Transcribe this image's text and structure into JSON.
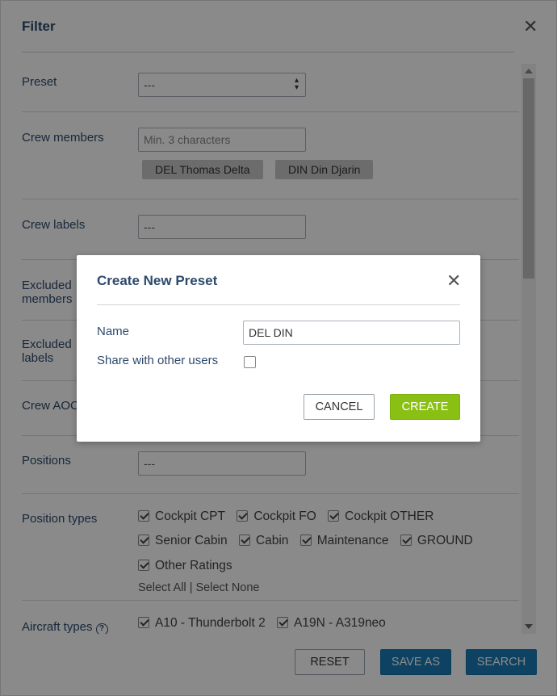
{
  "filter": {
    "title": "Filter",
    "preset": {
      "label": "Preset",
      "value": "---"
    },
    "crew_members": {
      "label": "Crew members",
      "placeholder": "Min. 3 characters",
      "chips": [
        "DEL Thomas Delta",
        "DIN Din Djarin"
      ]
    },
    "crew_labels": {
      "label": "Crew labels",
      "value": "---"
    },
    "excluded_members": {
      "label_line1": "Excluded",
      "label_line2": "members"
    },
    "excluded_labels": {
      "label_line1": "Excluded",
      "label_line2": "labels"
    },
    "crew_aoc": {
      "label": "Crew AOC"
    },
    "positions": {
      "label": "Positions",
      "value": "---"
    },
    "position_types": {
      "label": "Position types",
      "items": [
        {
          "label": "Cockpit CPT",
          "checked": true
        },
        {
          "label": "Cockpit FO",
          "checked": true
        },
        {
          "label": "Cockpit OTHER",
          "checked": true
        },
        {
          "label": "Senior Cabin",
          "checked": true
        },
        {
          "label": "Cabin",
          "checked": true
        },
        {
          "label": "Maintenance",
          "checked": true
        },
        {
          "label": "GROUND",
          "checked": true
        },
        {
          "label": "Other Ratings",
          "checked": true
        }
      ],
      "select_all": "Select All",
      "separator": "|",
      "select_none": "Select None"
    },
    "aircraft_types": {
      "label": "Aircraft types",
      "help": "?",
      "items": [
        {
          "label": "A10 - Thunderbolt 2",
          "checked": true
        },
        {
          "label": "A19N - A319neo",
          "checked": true
        }
      ]
    },
    "buttons": {
      "reset": "RESET",
      "save_as": "SAVE AS",
      "search": "SEARCH"
    },
    "close_glyph": "✕"
  },
  "modal": {
    "title": "Create New Preset",
    "close_glyph": "✕",
    "name_label": "Name",
    "name_value": "DEL DIN",
    "share_label": "Share with other users",
    "share_checked": false,
    "cancel": "CANCEL",
    "create": "CREATE"
  },
  "colors": {
    "title": "#2d4a6b",
    "blue_button": "#1a7ab8",
    "green_button": "#8ac014",
    "chip": "#c8c8c8"
  }
}
